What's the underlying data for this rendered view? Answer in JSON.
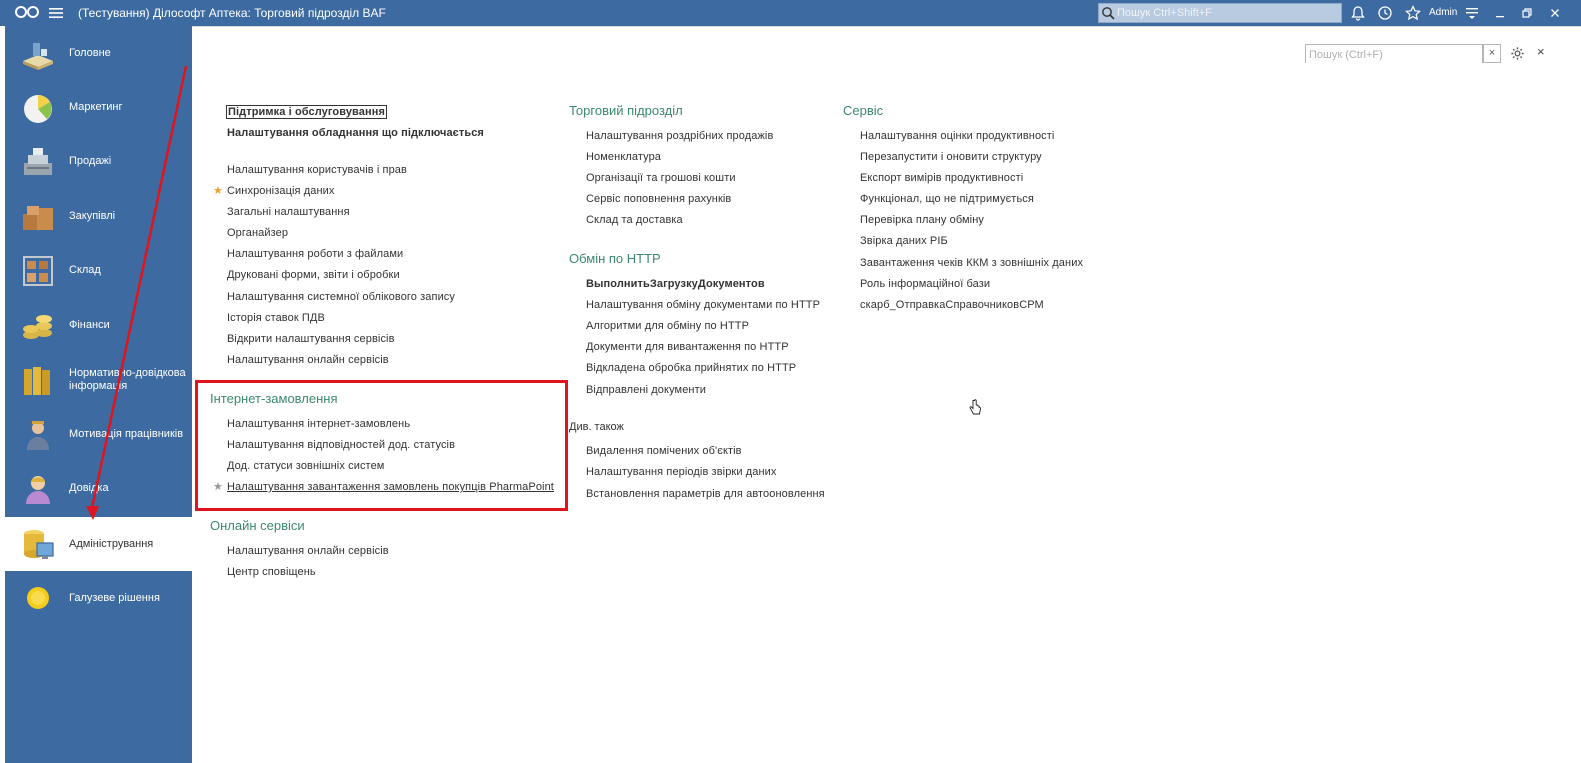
{
  "titlebar": {
    "title": "(Тестування) Дiлософт Аптека: Торговий пiдроздiл BAF",
    "search_placeholder": "Пошук Ctrl+Shift+F",
    "user": "Admin"
  },
  "sidebar": {
    "items": [
      {
        "label": "Головне",
        "icon": "home-desk-icon"
      },
      {
        "label": "Маркетинг",
        "icon": "pie-chart-icon"
      },
      {
        "label": "Продажі",
        "icon": "cash-register-icon"
      },
      {
        "label": "Закупівлі",
        "icon": "boxes-icon"
      },
      {
        "label": "Склад",
        "icon": "warehouse-shelf-icon"
      },
      {
        "label": "Фінанси",
        "icon": "coins-icon"
      },
      {
        "label": "Нормативно-довідкова інформація",
        "icon": "binders-icon"
      },
      {
        "label": "Мотивація працівників",
        "icon": "worker-icon"
      },
      {
        "label": "Довідка",
        "icon": "help-person-icon"
      },
      {
        "label": "Адміністрування",
        "icon": "admin-database-icon"
      },
      {
        "label": "Галузеве рішення",
        "icon": "sun-icon"
      }
    ],
    "active_index": 9
  },
  "content": {
    "search_placeholder": "Пошук (Ctrl+F)",
    "clear_label": "×",
    "close_label": "×",
    "col1": {
      "top_links": [
        "Підтримка і обслуговування",
        "Налаштування обладнання що підключається"
      ],
      "links": [
        "Налаштування користувачів і прав",
        "Синхронізація даних",
        "Загальні налаштування",
        "Органайзер",
        "Налаштування роботи з файлами",
        "Друковані форми, звіти і обробки",
        "Налаштування системної облікового запису",
        "Історія ставок ПДВ",
        "Відкрити налаштування сервісів",
        "Налаштування онлайн сервісів"
      ],
      "internet_title": "Інтернет-замовлення",
      "internet_links": [
        "Налаштування інтернет-замовлень",
        "Налаштування відповідностей дод. статусів",
        "Дод. статуси зовнішніх систем",
        "Налаштування завантаження замовлень покупців PharmaPoint"
      ],
      "online_title": "Онлайн сервіси",
      "online_links": [
        "Налаштування онлайн сервісів",
        "Центр сповіщень"
      ]
    },
    "col2": {
      "trade_title": "Торговий підрозділ",
      "trade_links": [
        "Налаштування роздрібних продажів",
        "Номенклатура",
        "Організації та грошові кошти",
        "Сервіс поповнення рахунків",
        "Склад та доставка"
      ],
      "http_title": "Обмін по HTTP",
      "http_links": [
        "ВыполнитьЗагрузкуДокументов",
        "Налаштування обміну документами по HTTP",
        "Алгоритми для обміну по HTTP",
        "Документи для вивантаження по HTTP",
        "Відкладена обробка прийнятих по HTTP",
        "Відправлені документи"
      ],
      "see_also": "Див. також",
      "see_links": [
        "Видалення помічених об'єктів",
        "Налаштування періодів звірки даних",
        "Встановлення параметрів для автооновлення"
      ]
    },
    "col3": {
      "service_title": "Сервіс",
      "service_links": [
        "Налаштування оцінки продуктивності",
        "Перезапустити і оновити структуру",
        "Експорт вимірів продуктивності",
        "Функціонал, що не підтримується",
        "Перевірка плану обміну",
        "Звірка даних РІБ",
        "Завантаження чеків ККМ з зовнішніх даних",
        "Роль інформаційної бази",
        "скарб_ОтправкаСправочниковСРМ"
      ]
    },
    "colors": {
      "header_bg": "#3d6ba1",
      "section_title": "#3b8a6e",
      "annotation_red": "#e0141c",
      "star_orange": "#f0a030",
      "star_gray": "#999999"
    }
  }
}
